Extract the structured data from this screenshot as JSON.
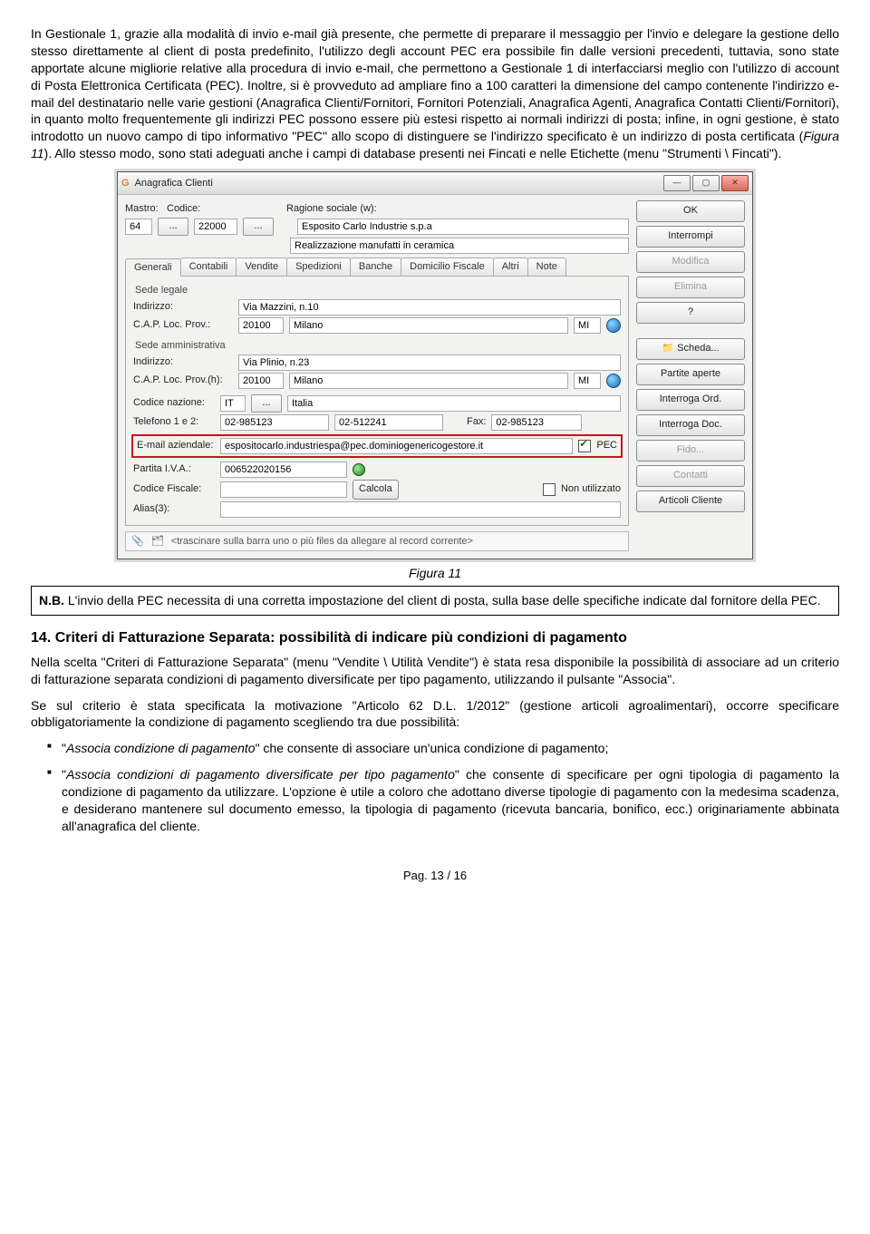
{
  "para1": "In Gestionale 1, grazie alla modalità di invio e-mail già presente, che permette di preparare il messaggio per l'invio e delegare la gestione dello stesso direttamente al client di posta predefinito, l'utilizzo degli account PEC era possibile fin dalle versioni precedenti, tuttavia, sono state apportate alcune migliorie relative alla procedura di invio e-mail, che permettono a Gestionale 1 di interfacciarsi meglio con l'utilizzo di account di Posta Elettronica Certificata (PEC). Inoltre, si è provveduto ad ampliare fino a 100 caratteri la dimensione del campo contenente l'indirizzo e-mail del destinatario nelle varie gestioni (Anagrafica Clienti/Fornitori, Fornitori Potenziali, Anagrafica Agenti, Anagrafica Contatti Clienti/Fornitori), in quanto molto frequentemente gli indirizzi PEC possono essere più estesi rispetto ai normali indirizzi di posta; infine, in ogni gestione, è stato introdotto un nuovo campo di tipo informativo \"PEC\" allo scopo di distinguere se l'indirizzo specificato è un indirizzo di posta certificata (",
  "para1_fig": "Figura 11",
  "para1_tail": "). Allo stesso modo, sono stati adeguati anche i campi di database presenti nei Fincati e nelle Etichette (menu \"Strumenti \\ Fincati\").",
  "caption": "Figura 11",
  "nb_lead": "N.B.",
  "nb_text": " L'invio della PEC necessita di una corretta impostazione del client di posta, sulla base delle specifiche indicate dal fornitore della PEC.",
  "section_title": "14. Criteri di Fatturazione Separata: possibilità di indicare più condizioni di pagamento",
  "s14_p1": "Nella scelta \"Criteri di Fatturazione Separata\" (menu \"Vendite \\ Utilità Vendite\") è stata resa disponibile la possibilità di associare ad un criterio di fatturazione separata condizioni di pagamento diversificate per tipo pagamento, utilizzando il pulsante \"Associa\".",
  "s14_p2": "Se sul criterio è stata specificata la motivazione \"Articolo 62 D.L. 1/2012\" (gestione articoli agroalimentari), occorre specificare obbligatoriamente la condizione di pagamento scegliendo tra due possibilità:",
  "bullets": [
    {
      "lead": "Associa condizione di pagamento",
      "rest": " che consente di associare un'unica condizione di pagamento;"
    },
    {
      "lead": "Associa condizioni di pagamento diversificate per tipo pagamento",
      "rest": " che consente di specificare per ogni tipologia di pagamento la condizione di pagamento da utilizzare. L'opzione è utile a coloro che adottano diverse tipologie di pagamento con la medesima scadenza, e desiderano mantenere sul documento emesso, la tipologia di pagamento (ricevuta bancaria, bonifico, ecc.) originariamente abbinata all'anagrafica del cliente."
    }
  ],
  "pagenum": "Pag. 13 / 16",
  "dialog": {
    "title": "Anagrafica Clienti",
    "labels": {
      "mastro": "Mastro:",
      "codice": "Codice:",
      "ragione": "Ragione sociale (w):",
      "sede_leg": "Sede legale",
      "indirizzo": "Indirizzo:",
      "cap_loc_prov": "C.A.P.   Loc.   Prov.:",
      "sede_amm": "Sede amministrativa",
      "cap_loc_provh": "C.A.P.  Loc.   Prov.(h):",
      "codnaz": "Codice nazione:",
      "tel": "Telefono 1 e 2:",
      "fax": "Fax:",
      "email": "E-mail aziendale:",
      "pec": "PEC",
      "piva": "Partita I.V.A.:",
      "cf": "Codice Fiscale:",
      "calcola": "Calcola",
      "nonutil": "Non utilizzato",
      "alias": "Alias(3):",
      "drag": "<trascinare sulla barra uno o più files da allegare al record corrente>"
    },
    "tabs": [
      "Generali",
      "Contabili",
      "Vendite",
      "Spedizioni",
      "Banche",
      "Domicilio Fiscale",
      "Altri",
      "Note"
    ],
    "fields": {
      "mastro": "64",
      "codice": "22000",
      "ragione1": "Esposito Carlo Industrie s.p.a",
      "ragione2": "Realizzazione manufatti in ceramica",
      "ind1": "Via Mazzini, n.10",
      "cap1": "20100",
      "loc1": "Milano",
      "prov1": "MI",
      "ind2": "Via Plinio, n.23",
      "cap2": "20100",
      "loc2": "Milano",
      "prov2": "MI",
      "naz_code": "IT",
      "naz_desc": "Italia",
      "tel1": "02-985123",
      "tel2": "02-512241",
      "fax": "02-985123",
      "email": "espositocarlo.industriespa@pec.dominiogenericogestore.it",
      "piva": "006522020156"
    },
    "buttons": {
      "ok": "OK",
      "interrompi": "Interrompi",
      "modifica": "Modifica",
      "elimina": "Elimina",
      "help": "?",
      "scheda": "Scheda...",
      "partite": "Partite aperte",
      "intord": "Interroga Ord.",
      "intdoc": "Interroga Doc.",
      "fido": "Fido...",
      "contatti": "Contatti",
      "artcli": "Articoli Cliente"
    }
  }
}
